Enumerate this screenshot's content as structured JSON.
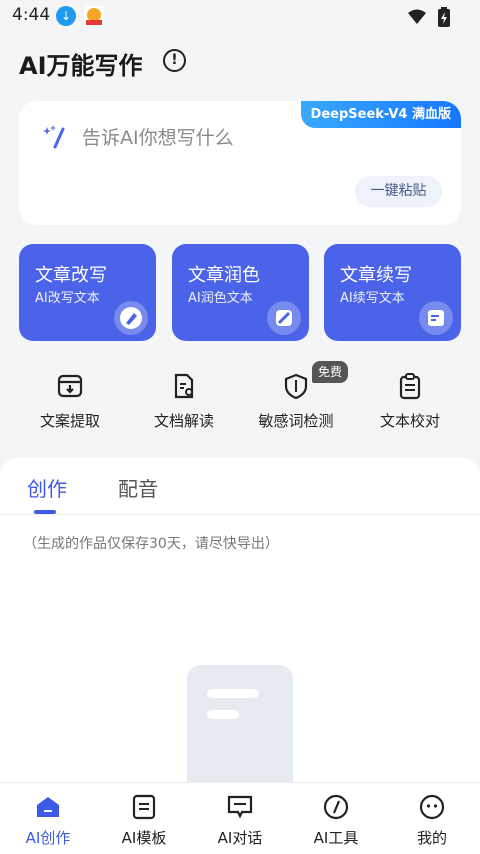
{
  "status_bar": {
    "time": "4:44"
  },
  "header": {
    "title": "AI万能写作"
  },
  "input_card": {
    "model_badge": "DeepSeek-V4 满血版",
    "placeholder": "告诉AI你想写什么",
    "paste_label": "一键粘贴"
  },
  "feature_cards": [
    {
      "title": "文章改写",
      "subtitle": "AI改写文本",
      "icon": "pen-icon"
    },
    {
      "title": "文章润色",
      "subtitle": "AI润色文本",
      "icon": "magic-wand-icon"
    },
    {
      "title": "文章续写",
      "subtitle": "AI续写文本",
      "icon": "edit-note-icon"
    }
  ],
  "tools": [
    {
      "label": "文案提取",
      "icon": "extract-icon"
    },
    {
      "label": "文档解读",
      "icon": "document-read-icon"
    },
    {
      "label": "敏感词检测",
      "icon": "shield-icon",
      "badge": "免费"
    },
    {
      "label": "文本校对",
      "icon": "clipboard-check-icon"
    }
  ],
  "tabs": [
    {
      "label": "创作",
      "active": true
    },
    {
      "label": "配音",
      "active": false
    }
  ],
  "notice": "（生成的作品仅保存30天，请尽快导出）",
  "bottom_nav": [
    {
      "label": "AI创作",
      "icon": "home-icon",
      "active": true
    },
    {
      "label": "AI模板",
      "icon": "template-icon",
      "active": false
    },
    {
      "label": "AI对话",
      "icon": "chat-icon",
      "active": false
    },
    {
      "label": "AI工具",
      "icon": "compass-icon",
      "active": false
    },
    {
      "label": "我的",
      "icon": "profile-icon",
      "active": false
    }
  ],
  "colors": {
    "accent": "#3d5be6",
    "card": "#4a63e8",
    "background": "#f4f5f7"
  }
}
